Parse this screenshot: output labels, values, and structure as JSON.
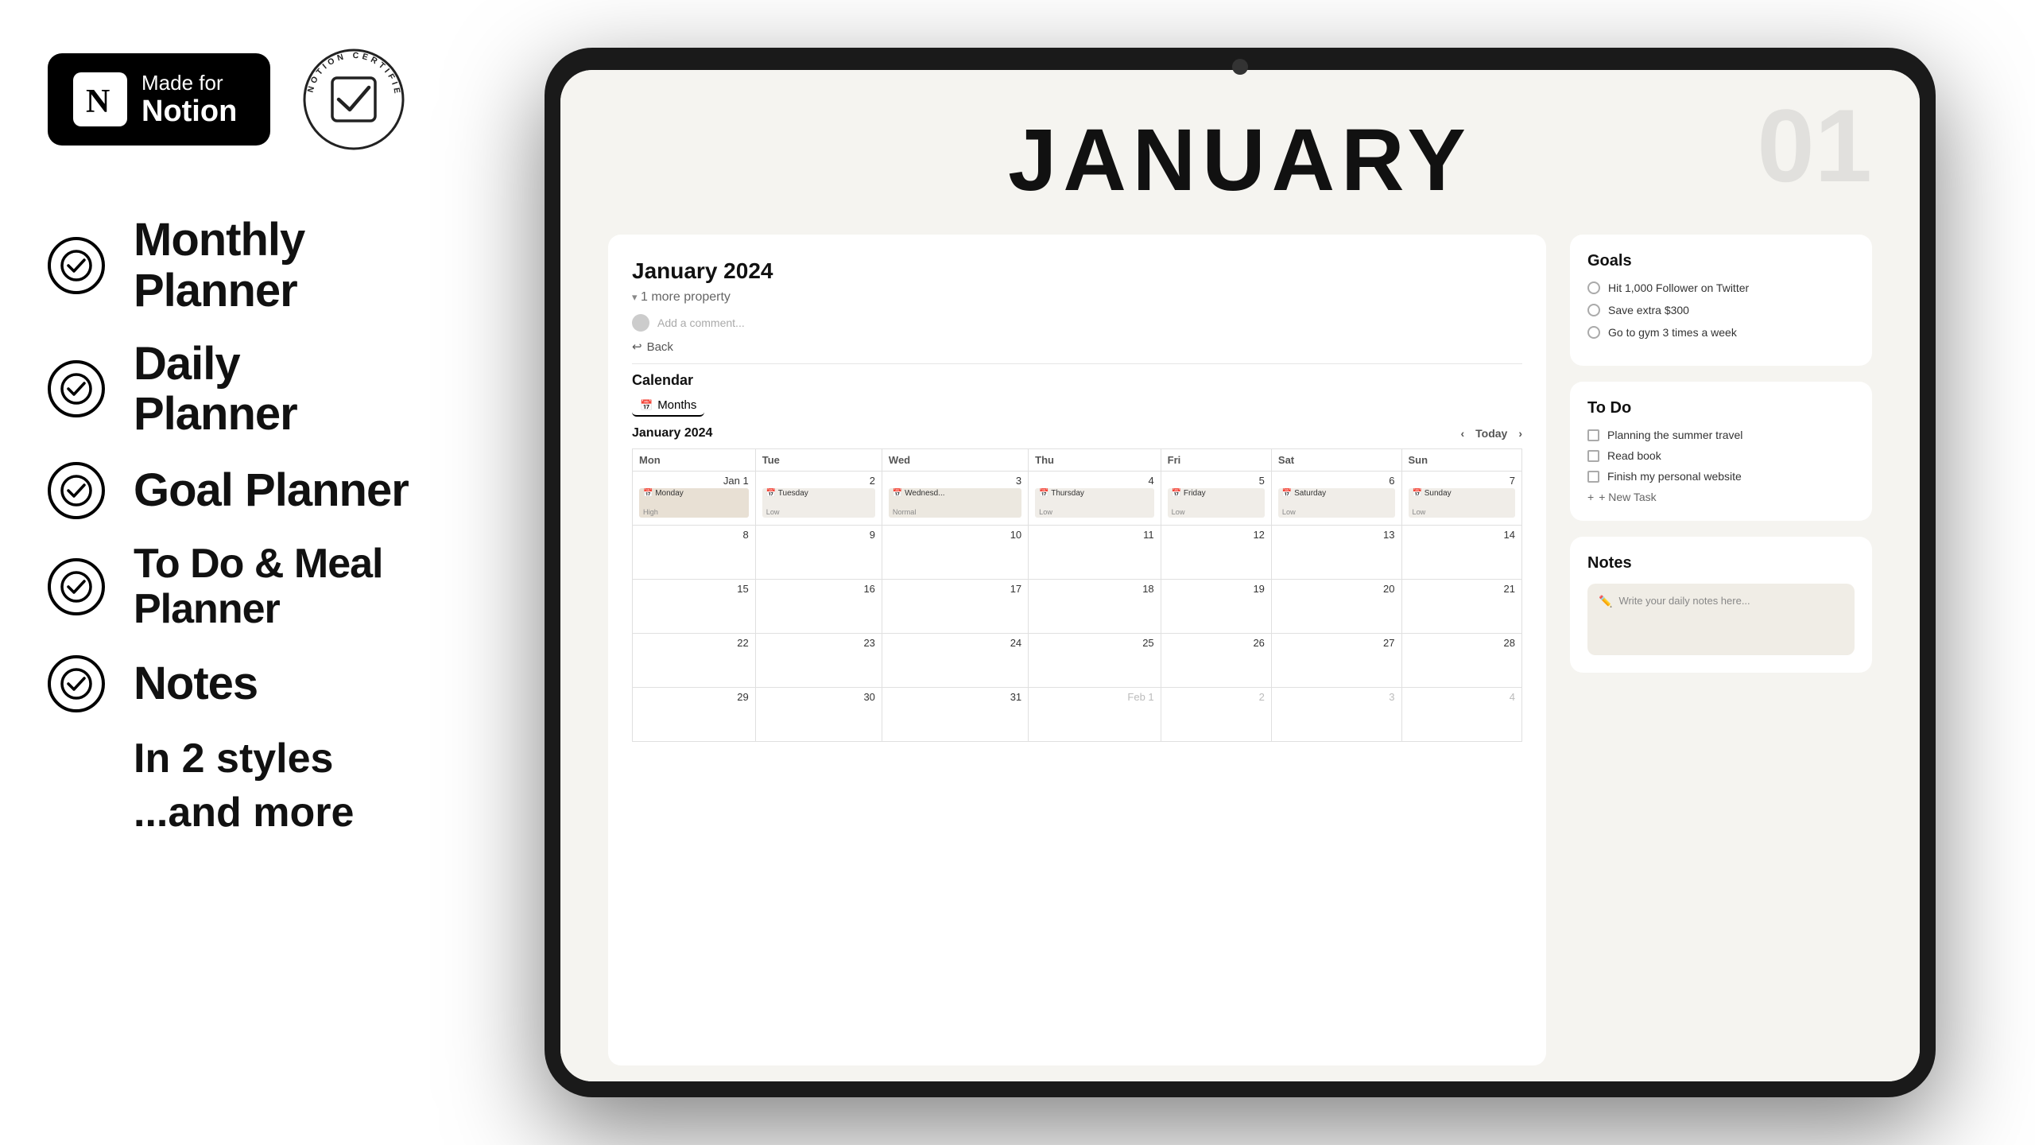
{
  "left": {
    "notion_badge": {
      "made_for": "Made for",
      "notion": "Notion",
      "n_letter": "N"
    },
    "certified_badge": {
      "top_text": "CERTIFIED",
      "bottom_text": "NOTION",
      "left_text": "NOTION",
      "right_text": "CERTIFIED"
    },
    "features": [
      {
        "label": "Monthly Planner"
      },
      {
        "label": "Daily Planner"
      },
      {
        "label": "Goal Planner"
      },
      {
        "label": "To Do & Meal Planner"
      },
      {
        "label": "Notes"
      }
    ],
    "extra1": "In 2 styles",
    "extra2": "...and more"
  },
  "right": {
    "page_title": "JANUARY",
    "page_number": "01",
    "section_title": "January 2024",
    "property_label": "1 more property",
    "comment_placeholder": "Add a comment...",
    "back_label": "Back",
    "calendar_label": "Calendar",
    "months_tab": "Months",
    "calendar_month": "January 2024",
    "today_btn": "Today",
    "days": [
      "Mon",
      "Tue",
      "Wed",
      "Thu",
      "Fri",
      "Sat",
      "Sun"
    ],
    "week1": [
      {
        "num": "Jan 1",
        "event": "Monday",
        "tag": "High"
      },
      {
        "num": "2",
        "event": "Tuesday",
        "tag": "Low"
      },
      {
        "num": "3",
        "event": "Wednesd...",
        "tag": "Normal"
      },
      {
        "num": "4",
        "event": "Thursday",
        "tag": "Low"
      },
      {
        "num": "5",
        "event": "Friday",
        "tag": "Low"
      },
      {
        "num": "6",
        "event": "Saturday",
        "tag": "Low"
      },
      {
        "num": "7",
        "event": "Sunday",
        "tag": "Low"
      }
    ],
    "week2_nums": [
      "8",
      "9",
      "10",
      "11",
      "12",
      "13",
      "14"
    ],
    "week3_nums": [
      "15",
      "16",
      "17",
      "18",
      "19",
      "20",
      "21"
    ],
    "week4_nums": [
      "22",
      "23",
      "24",
      "25",
      "26",
      "27",
      "28"
    ],
    "week5_nums": [
      "29",
      "30",
      "31",
      "Feb 1",
      "2",
      "3",
      "4"
    ],
    "goals_title": "Goals",
    "goals": [
      "Hit 1,000 Follower on Twitter",
      "Save extra $300",
      "Go to gym 3 times a week"
    ],
    "todo_title": "To Do",
    "todos": [
      "Planning the summer travel",
      "Read book",
      "Finish my personal website"
    ],
    "new_task_label": "+ New Task",
    "notes_title": "Notes",
    "notes_placeholder": "Write your daily notes here..."
  }
}
